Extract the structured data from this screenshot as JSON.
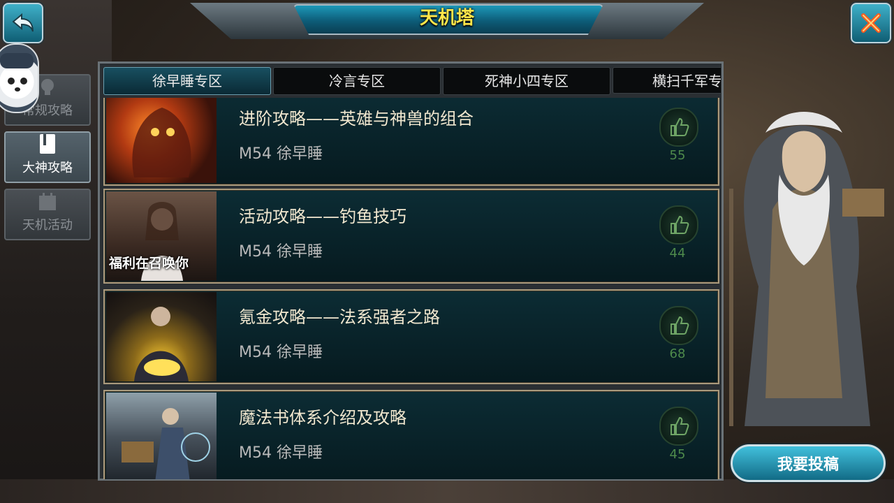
{
  "header": {
    "title": "天机塔"
  },
  "side_nav": {
    "items": [
      {
        "label": "常规攻略",
        "icon": "lightbulb-icon",
        "active": false
      },
      {
        "label": "大神攻略",
        "icon": "book-icon",
        "active": true
      },
      {
        "label": "天机活动",
        "icon": "calendar-icon",
        "active": false
      }
    ]
  },
  "tabs": [
    {
      "label": "徐早睡专区",
      "active": true
    },
    {
      "label": "冷言专区",
      "active": false
    },
    {
      "label": "死神小四专区",
      "active": false
    },
    {
      "label": "横扫千军专区",
      "active": false
    }
  ],
  "articles": [
    {
      "title": "进阶攻略——英雄与神兽的组合",
      "author": "M54 徐早睡",
      "likes": "55",
      "thumb_caption": ""
    },
    {
      "title": "活动攻略——钓鱼技巧",
      "author": "M54 徐早睡",
      "likes": "44",
      "thumb_caption": "福利在召唤你"
    },
    {
      "title": "氪金攻略——法系强者之路",
      "author": "M54 徐早睡",
      "likes": "68",
      "thumb_caption": ""
    },
    {
      "title": "魔法书体系介绍及攻略",
      "author": "M54 徐早睡",
      "likes": "45",
      "thumb_caption": ""
    }
  ],
  "submit_button": {
    "label": "我要投稿"
  },
  "colors": {
    "title_text": "#ffe64a",
    "accent": "#1d98b8",
    "like_green": "#4e8a4b"
  }
}
